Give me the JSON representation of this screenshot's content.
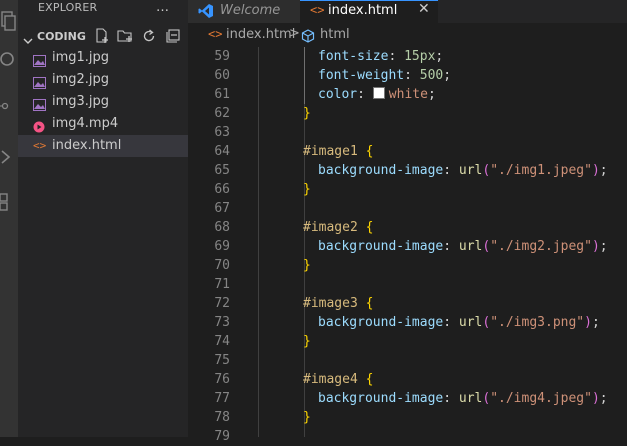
{
  "activity_bar": {
    "icons": [
      "explorer-icon",
      "search-icon",
      "source-control-icon",
      "run-debug-icon",
      "extensions-icon"
    ]
  },
  "sidebar": {
    "title": "EXPLORER",
    "more_icon": "…",
    "section": {
      "title": "CODING",
      "actions": [
        "new-file-icon",
        "new-folder-icon",
        "refresh-icon",
        "collapse-all-icon"
      ]
    },
    "files": [
      {
        "name": "img1.jpg",
        "icon": "image-icon",
        "color": "#a074c4"
      },
      {
        "name": "img2.jpg",
        "icon": "image-icon",
        "color": "#a074c4"
      },
      {
        "name": "img3.jpg",
        "icon": "image-icon",
        "color": "#a074c4"
      },
      {
        "name": "img4.mp4",
        "icon": "video-icon",
        "color": "#f55385"
      },
      {
        "name": "index.html",
        "icon": "html-icon",
        "color": "#e37933",
        "selected": true
      }
    ]
  },
  "tabs": [
    {
      "label": "Welcome",
      "icon": "vscode-icon",
      "active": false
    },
    {
      "label": "index.html",
      "icon": "html-icon",
      "active": true,
      "close": "✕"
    }
  ],
  "breadcrumb": {
    "file": "index.html",
    "separator": ">",
    "element": "html"
  },
  "editor": {
    "lines": [
      {
        "num": "59",
        "indent": 2,
        "tokens": [
          [
            "prop",
            "font-size"
          ],
          [
            "punct",
            ": "
          ],
          [
            "num",
            "15px"
          ],
          [
            "punct",
            ";"
          ]
        ]
      },
      {
        "num": "60",
        "indent": 2,
        "tokens": [
          [
            "prop",
            "font-weight"
          ],
          [
            "punct",
            ": "
          ],
          [
            "num",
            "500"
          ],
          [
            "punct",
            ";"
          ]
        ]
      },
      {
        "num": "61",
        "indent": 2,
        "tokens": [
          [
            "prop",
            "color"
          ],
          [
            "punct",
            ": "
          ],
          [
            "swatch",
            ""
          ],
          [
            "str",
            "white"
          ],
          [
            "punct",
            ";"
          ]
        ]
      },
      {
        "num": "62",
        "indent": 1,
        "tokens": [
          [
            "brace",
            "}"
          ]
        ]
      },
      {
        "num": "63",
        "indent": 1,
        "tokens": []
      },
      {
        "num": "64",
        "indent": 1,
        "tokens": [
          [
            "sel",
            "#image1"
          ],
          [
            "punct",
            " "
          ],
          [
            "brace",
            "{"
          ]
        ]
      },
      {
        "num": "65",
        "indent": 2,
        "tokens": [
          [
            "prop",
            "background-image"
          ],
          [
            "punct",
            ": "
          ],
          [
            "fn",
            "url"
          ],
          [
            "paren",
            "("
          ],
          [
            "str",
            "\"./img1.jpeg\""
          ],
          [
            "paren",
            ")"
          ],
          [
            "punct",
            ";"
          ]
        ]
      },
      {
        "num": "66",
        "indent": 1,
        "tokens": [
          [
            "brace",
            "}"
          ]
        ]
      },
      {
        "num": "67",
        "indent": 1,
        "tokens": []
      },
      {
        "num": "68",
        "indent": 1,
        "tokens": [
          [
            "sel",
            "#image2"
          ],
          [
            "punct",
            " "
          ],
          [
            "brace",
            "{"
          ]
        ]
      },
      {
        "num": "69",
        "indent": 2,
        "tokens": [
          [
            "prop",
            "background-image"
          ],
          [
            "punct",
            ": "
          ],
          [
            "fn",
            "url"
          ],
          [
            "paren",
            "("
          ],
          [
            "str",
            "\"./img2.jpeg\""
          ],
          [
            "paren",
            ")"
          ],
          [
            "punct",
            ";"
          ]
        ]
      },
      {
        "num": "70",
        "indent": 1,
        "tokens": [
          [
            "brace",
            "}"
          ]
        ]
      },
      {
        "num": "71",
        "indent": 1,
        "tokens": []
      },
      {
        "num": "72",
        "indent": 1,
        "tokens": [
          [
            "sel",
            "#image3"
          ],
          [
            "punct",
            " "
          ],
          [
            "brace",
            "{"
          ]
        ]
      },
      {
        "num": "73",
        "indent": 2,
        "tokens": [
          [
            "prop",
            "background-image"
          ],
          [
            "punct",
            ": "
          ],
          [
            "fn",
            "url"
          ],
          [
            "paren",
            "("
          ],
          [
            "str",
            "\"./img3.png\""
          ],
          [
            "paren",
            ")"
          ],
          [
            "punct",
            ";"
          ]
        ]
      },
      {
        "num": "74",
        "indent": 1,
        "tokens": [
          [
            "brace",
            "}"
          ]
        ]
      },
      {
        "num": "75",
        "indent": 1,
        "tokens": []
      },
      {
        "num": "76",
        "indent": 1,
        "tokens": [
          [
            "sel",
            "#image4"
          ],
          [
            "punct",
            " "
          ],
          [
            "brace",
            "{"
          ]
        ]
      },
      {
        "num": "77",
        "indent": 2,
        "tokens": [
          [
            "prop",
            "background-image"
          ],
          [
            "punct",
            ": "
          ],
          [
            "fn",
            "url"
          ],
          [
            "paren",
            "("
          ],
          [
            "str",
            "\"./img4.jpeg\""
          ],
          [
            "paren",
            ")"
          ],
          [
            "punct",
            ";"
          ]
        ]
      },
      {
        "num": "78",
        "indent": 1,
        "tokens": [
          [
            "brace",
            "}"
          ]
        ]
      },
      {
        "num": "79",
        "indent": 1,
        "tokens": []
      }
    ]
  },
  "colors": {
    "editor_bg": "#1e1e1e",
    "sidebar_bg": "#252526",
    "activity_bg": "#333333",
    "accent": "#3794ff"
  }
}
